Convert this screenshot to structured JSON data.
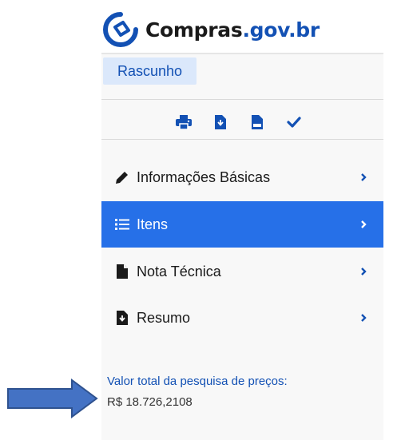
{
  "logo": {
    "name_part": "Compras",
    "domain_part": ".gov.br"
  },
  "status": {
    "badge": "Rascunho"
  },
  "toolbar": {
    "icons": [
      "print-icon",
      "download-file-icon",
      "csv-file-icon",
      "check-icon"
    ]
  },
  "menu": {
    "items": [
      {
        "label": "Informações Básicas",
        "icon": "pencil-icon",
        "active": false
      },
      {
        "label": "Itens",
        "icon": "list-icon",
        "active": true
      },
      {
        "label": "Nota Técnica",
        "icon": "file-icon",
        "active": false
      },
      {
        "label": "Resumo",
        "icon": "file-download-icon",
        "active": false
      }
    ]
  },
  "summary": {
    "total_label": "Valor total da pesquisa de preços:",
    "total_value": "R$ 18.726,2108"
  },
  "colors": {
    "brand_blue": "#1351b4",
    "active_item": "#2670e8",
    "badge_bg": "#dbe8fb",
    "arrow": "#4472c4"
  }
}
